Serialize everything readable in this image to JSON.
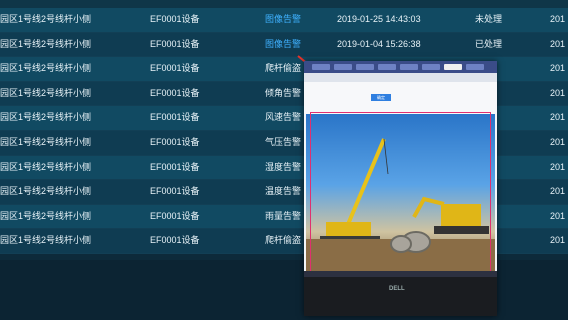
{
  "rows": [
    {
      "location": "园区1号线2号线杆小侧",
      "device": "EF0001设备",
      "alarm_type": "图像告警",
      "time": "2019-01-25 14:43:03",
      "status": "未处理",
      "extra": "201"
    },
    {
      "location": "园区1号线2号线杆小侧",
      "device": "EF0001设备",
      "alarm_type": "图像告警",
      "time": "2019-01-04 15:26:38",
      "status": "已处理",
      "extra": "201"
    },
    {
      "location": "园区1号线2号线杆小侧",
      "device": "EF0001设备",
      "alarm_type": "爬杆偷盗",
      "time": "",
      "status": "",
      "extra": "201"
    },
    {
      "location": "园区1号线2号线杆小侧",
      "device": "EF0001设备",
      "alarm_type": "倾角告警",
      "time": "",
      "status": "",
      "extra": "201"
    },
    {
      "location": "园区1号线2号线杆小侧",
      "device": "EF0001设备",
      "alarm_type": "风速告警",
      "time": "",
      "status": "",
      "extra": "201"
    },
    {
      "location": "园区1号线2号线杆小侧",
      "device": "EF0001设备",
      "alarm_type": "气压告警",
      "time": "",
      "status": "",
      "extra": "201"
    },
    {
      "location": "园区1号线2号线杆小侧",
      "device": "EF0001设备",
      "alarm_type": "湿度告警",
      "time": "",
      "status": "",
      "extra": "201"
    },
    {
      "location": "园区1号线2号线杆小侧",
      "device": "EF0001设备",
      "alarm_type": "温度告警",
      "time": "",
      "status": "",
      "extra": "201"
    },
    {
      "location": "园区1号线2号线杆小侧",
      "device": "EF0001设备",
      "alarm_type": "雨量告警",
      "time": "",
      "status": "",
      "extra": "201"
    },
    {
      "location": "园区1号线2号线杆小侧",
      "device": "EF0001设备",
      "alarm_type": "爬杆偷盗",
      "time": "",
      "status": "",
      "extra": "201"
    }
  ],
  "popup": {
    "brand_text": "DELL",
    "button_label": "确定"
  },
  "colors": {
    "link": "#3fb1ff",
    "arrow": "#e8332a",
    "frame": "#e0306f"
  }
}
